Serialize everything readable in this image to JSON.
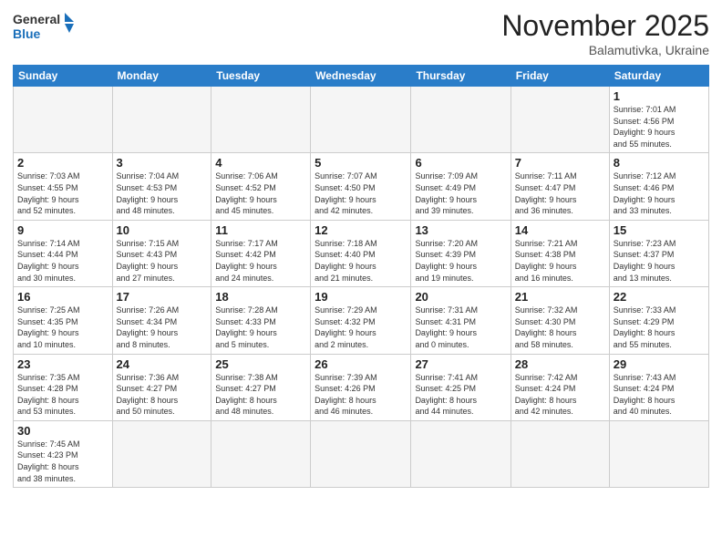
{
  "logo": {
    "text_general": "General",
    "text_blue": "Blue"
  },
  "title": "November 2025",
  "location": "Balamutivka, Ukraine",
  "days_of_week": [
    "Sunday",
    "Monday",
    "Tuesday",
    "Wednesday",
    "Thursday",
    "Friday",
    "Saturday"
  ],
  "weeks": [
    [
      {
        "day": "",
        "info": ""
      },
      {
        "day": "",
        "info": ""
      },
      {
        "day": "",
        "info": ""
      },
      {
        "day": "",
        "info": ""
      },
      {
        "day": "",
        "info": ""
      },
      {
        "day": "",
        "info": ""
      },
      {
        "day": "1",
        "info": "Sunrise: 7:01 AM\nSunset: 4:56 PM\nDaylight: 9 hours\nand 55 minutes."
      }
    ],
    [
      {
        "day": "2",
        "info": "Sunrise: 7:03 AM\nSunset: 4:55 PM\nDaylight: 9 hours\nand 52 minutes."
      },
      {
        "day": "3",
        "info": "Sunrise: 7:04 AM\nSunset: 4:53 PM\nDaylight: 9 hours\nand 48 minutes."
      },
      {
        "day": "4",
        "info": "Sunrise: 7:06 AM\nSunset: 4:52 PM\nDaylight: 9 hours\nand 45 minutes."
      },
      {
        "day": "5",
        "info": "Sunrise: 7:07 AM\nSunset: 4:50 PM\nDaylight: 9 hours\nand 42 minutes."
      },
      {
        "day": "6",
        "info": "Sunrise: 7:09 AM\nSunset: 4:49 PM\nDaylight: 9 hours\nand 39 minutes."
      },
      {
        "day": "7",
        "info": "Sunrise: 7:11 AM\nSunset: 4:47 PM\nDaylight: 9 hours\nand 36 minutes."
      },
      {
        "day": "8",
        "info": "Sunrise: 7:12 AM\nSunset: 4:46 PM\nDaylight: 9 hours\nand 33 minutes."
      }
    ],
    [
      {
        "day": "9",
        "info": "Sunrise: 7:14 AM\nSunset: 4:44 PM\nDaylight: 9 hours\nand 30 minutes."
      },
      {
        "day": "10",
        "info": "Sunrise: 7:15 AM\nSunset: 4:43 PM\nDaylight: 9 hours\nand 27 minutes."
      },
      {
        "day": "11",
        "info": "Sunrise: 7:17 AM\nSunset: 4:42 PM\nDaylight: 9 hours\nand 24 minutes."
      },
      {
        "day": "12",
        "info": "Sunrise: 7:18 AM\nSunset: 4:40 PM\nDaylight: 9 hours\nand 21 minutes."
      },
      {
        "day": "13",
        "info": "Sunrise: 7:20 AM\nSunset: 4:39 PM\nDaylight: 9 hours\nand 19 minutes."
      },
      {
        "day": "14",
        "info": "Sunrise: 7:21 AM\nSunset: 4:38 PM\nDaylight: 9 hours\nand 16 minutes."
      },
      {
        "day": "15",
        "info": "Sunrise: 7:23 AM\nSunset: 4:37 PM\nDaylight: 9 hours\nand 13 minutes."
      }
    ],
    [
      {
        "day": "16",
        "info": "Sunrise: 7:25 AM\nSunset: 4:35 PM\nDaylight: 9 hours\nand 10 minutes."
      },
      {
        "day": "17",
        "info": "Sunrise: 7:26 AM\nSunset: 4:34 PM\nDaylight: 9 hours\nand 8 minutes."
      },
      {
        "day": "18",
        "info": "Sunrise: 7:28 AM\nSunset: 4:33 PM\nDaylight: 9 hours\nand 5 minutes."
      },
      {
        "day": "19",
        "info": "Sunrise: 7:29 AM\nSunset: 4:32 PM\nDaylight: 9 hours\nand 2 minutes."
      },
      {
        "day": "20",
        "info": "Sunrise: 7:31 AM\nSunset: 4:31 PM\nDaylight: 9 hours\nand 0 minutes."
      },
      {
        "day": "21",
        "info": "Sunrise: 7:32 AM\nSunset: 4:30 PM\nDaylight: 8 hours\nand 58 minutes."
      },
      {
        "day": "22",
        "info": "Sunrise: 7:33 AM\nSunset: 4:29 PM\nDaylight: 8 hours\nand 55 minutes."
      }
    ],
    [
      {
        "day": "23",
        "info": "Sunrise: 7:35 AM\nSunset: 4:28 PM\nDaylight: 8 hours\nand 53 minutes."
      },
      {
        "day": "24",
        "info": "Sunrise: 7:36 AM\nSunset: 4:27 PM\nDaylight: 8 hours\nand 50 minutes."
      },
      {
        "day": "25",
        "info": "Sunrise: 7:38 AM\nSunset: 4:27 PM\nDaylight: 8 hours\nand 48 minutes."
      },
      {
        "day": "26",
        "info": "Sunrise: 7:39 AM\nSunset: 4:26 PM\nDaylight: 8 hours\nand 46 minutes."
      },
      {
        "day": "27",
        "info": "Sunrise: 7:41 AM\nSunset: 4:25 PM\nDaylight: 8 hours\nand 44 minutes."
      },
      {
        "day": "28",
        "info": "Sunrise: 7:42 AM\nSunset: 4:24 PM\nDaylight: 8 hours\nand 42 minutes."
      },
      {
        "day": "29",
        "info": "Sunrise: 7:43 AM\nSunset: 4:24 PM\nDaylight: 8 hours\nand 40 minutes."
      }
    ],
    [
      {
        "day": "30",
        "info": "Sunrise: 7:45 AM\nSunset: 4:23 PM\nDaylight: 8 hours\nand 38 minutes."
      },
      {
        "day": "",
        "info": ""
      },
      {
        "day": "",
        "info": ""
      },
      {
        "day": "",
        "info": ""
      },
      {
        "day": "",
        "info": ""
      },
      {
        "day": "",
        "info": ""
      },
      {
        "day": "",
        "info": ""
      }
    ]
  ]
}
